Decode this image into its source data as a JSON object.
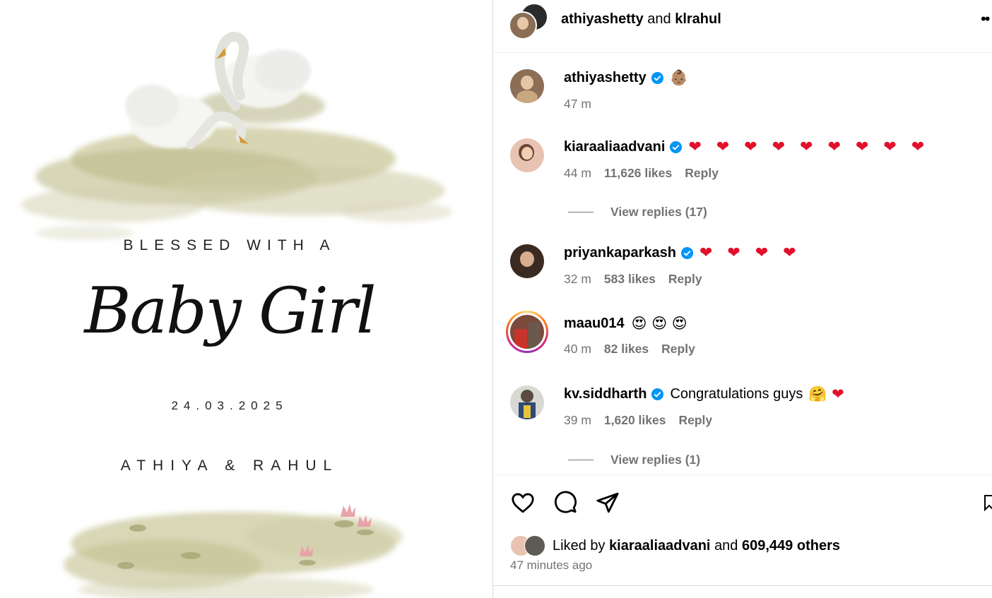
{
  "invitation": {
    "line1": "BLESSED WITH A",
    "script": "Baby Girl",
    "date": "24.03.2025",
    "names": "ATHIYA & RAHUL"
  },
  "header": {
    "user1": "athiyashetty",
    "joiner": "and",
    "user2": "klrahul",
    "more": "••"
  },
  "caption": {
    "username": "athiyashetty",
    "emoji": "👶🏽",
    "time": "47 m"
  },
  "comments": [
    {
      "username": "kiaraaliaadvani",
      "text": "❤ ❤ ❤ ❤ ❤ ❤ ❤ ❤ ❤",
      "time": "44 m",
      "likes": "11,626 likes",
      "reply": "Reply",
      "replies": "View replies (17)"
    },
    {
      "username": "priyankaparkash",
      "text": "❤ ❤ ❤ ❤",
      "time": "32 m",
      "likes": "583 likes",
      "reply": "Reply"
    },
    {
      "username": "maau014",
      "text": "😍 😍 😍",
      "time": "40 m",
      "likes": "82 likes",
      "reply": "Reply"
    },
    {
      "username": "kv.siddharth",
      "text": "Congratulations guys",
      "emoji": "🤗 ❤",
      "time": "39 m",
      "likes": "1,620 likes",
      "reply": "Reply",
      "replies": "View replies (1)"
    }
  ],
  "likes": {
    "prefix": "Liked by",
    "user": "kiaraaliaadvani",
    "joiner": "and",
    "others": "609,449 others",
    "time": "47 minutes ago"
  },
  "colors": {
    "heart": "#e2102a",
    "verified": "#0095f6",
    "muted": "#737373",
    "wash": "#b9b98a"
  }
}
